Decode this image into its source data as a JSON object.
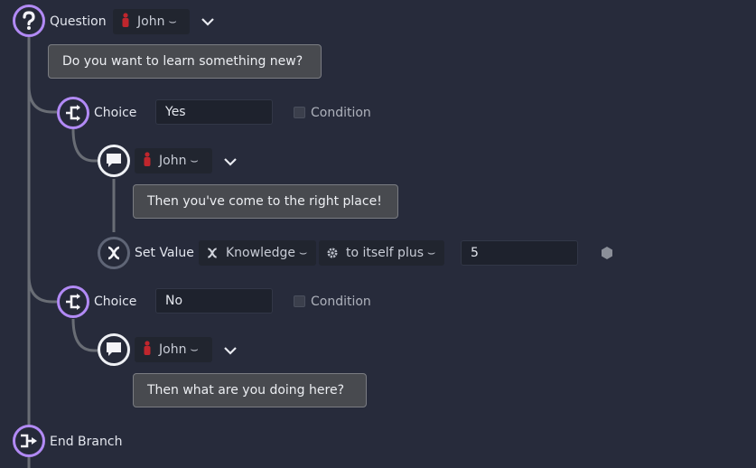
{
  "question": {
    "label": "Question",
    "character": "John",
    "text": "Do you want to learn something new?"
  },
  "choices": [
    {
      "label": "Choice",
      "value": "Yes",
      "condition_label": "Condition",
      "message": {
        "character": "John",
        "text": "Then you've come to the right place!"
      },
      "set_value": {
        "label": "Set Value",
        "variable": "Knowledge",
        "operation": "to itself plus",
        "amount": "5"
      }
    },
    {
      "label": "Choice",
      "value": "No",
      "condition_label": "Condition",
      "message": {
        "character": "John",
        "text": "Then what are you doing here?"
      }
    }
  ],
  "end_branch": {
    "label": "End Branch"
  },
  "colors": {
    "background": "#272b3b",
    "accent_purple": "#b28af5",
    "character_red": "#c0262d"
  }
}
